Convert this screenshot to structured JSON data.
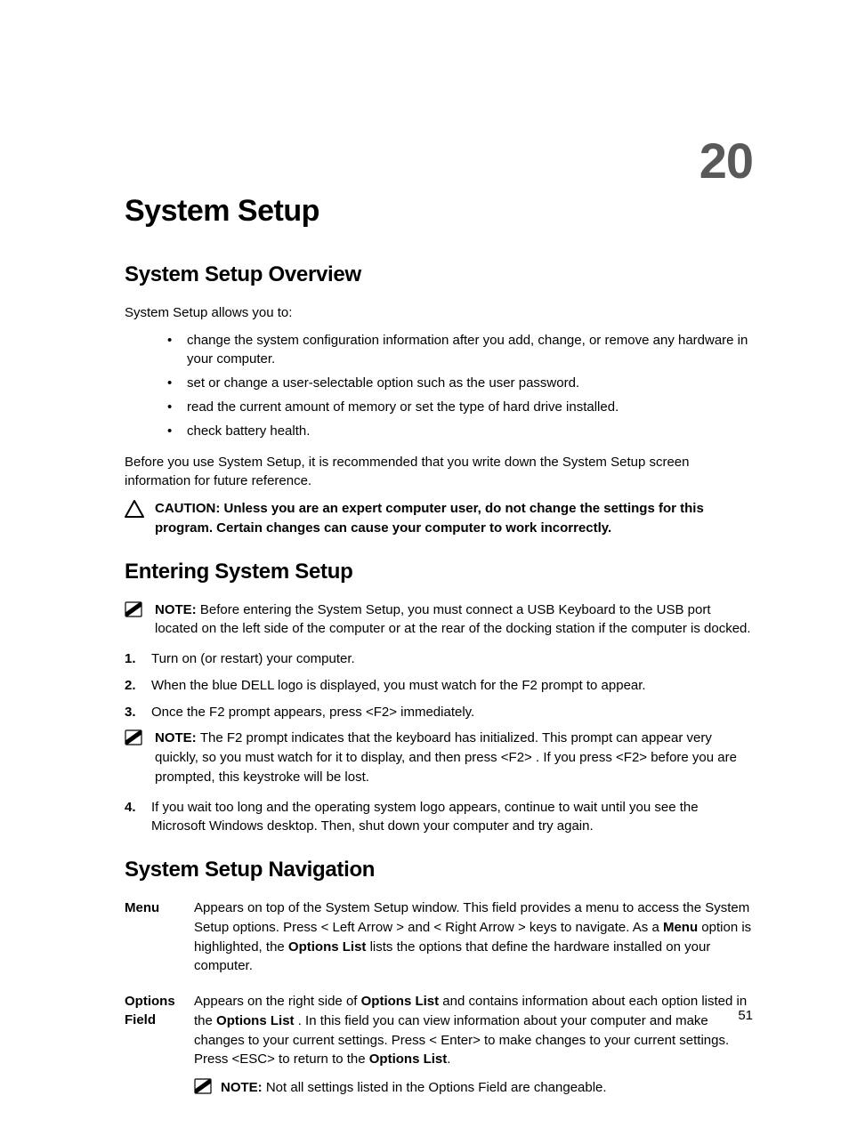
{
  "chapterNumber": "20",
  "h1": "System Setup",
  "h2_overview": "System Setup Overview",
  "p_intro": "System Setup allows you to:",
  "bullets": [
    "change the system configuration information after you add, change, or remove any hardware in your computer.",
    "set or change a user-selectable option such as the user password.",
    "read the current amount of memory or set the type of hard drive installed.",
    "check battery health."
  ],
  "p_before": "Before you use System Setup, it is recommended that you write down the System Setup screen information for future reference.",
  "caution_label": "CAUTION: ",
  "caution_text": "Unless you are an expert computer user, do not change the settings for this program. Certain changes can cause your computer to work incorrectly.",
  "h2_entering": "Entering System Setup",
  "note_label": "NOTE: ",
  "note1_text": "Before entering the System Setup, you must connect a USB Keyboard to the USB port located on the left side of the computer or at the rear of the docking station if the computer is docked.",
  "ol1": "Turn on (or restart) your computer.",
  "ol2": "When the blue DELL logo is displayed, you must watch for the F2 prompt to appear.",
  "ol3": "Once the F2 prompt appears, press <F2> immediately.",
  "note2_text": "The F2 prompt indicates that the keyboard has initialized. This prompt can appear very quickly, so you must watch for it to display, and then press <F2> . If you press <F2> before you are prompted, this keystroke will be lost.",
  "ol4": "If you wait too long and the operating system logo appears, continue to wait until you see the Microsoft Windows desktop. Then, shut down your computer and try again.",
  "h2_nav": "System Setup Navigation",
  "nav": {
    "menu_term": "Menu",
    "menu_desc_a": "Appears on top of the System Setup window. This field provides a menu to access the System Setup options. Press < Left Arrow > and < Right Arrow > keys to navigate. As a ",
    "menu_bold": "Menu",
    "menu_desc_b": " option is highlighted, the ",
    "menu_bold2": "Options List",
    "menu_desc_c": " lists the options that define the hardware installed on your computer.",
    "opt_term": "Options Field",
    "opt_a": "Appears on the right side of ",
    "opt_b1": "Options List",
    "opt_c": " and contains information about each option listed in the ",
    "opt_b2": "Options List ",
    "opt_d": ". In this field you can view information about your computer and make changes to your current settings. Press < Enter> to make changes to your current settings. Press <ESC> to return to the ",
    "opt_b3": "Options List",
    "opt_e": ".",
    "opt_note": "Not all settings listed in the Options Field are changeable."
  },
  "pageNum": "51"
}
